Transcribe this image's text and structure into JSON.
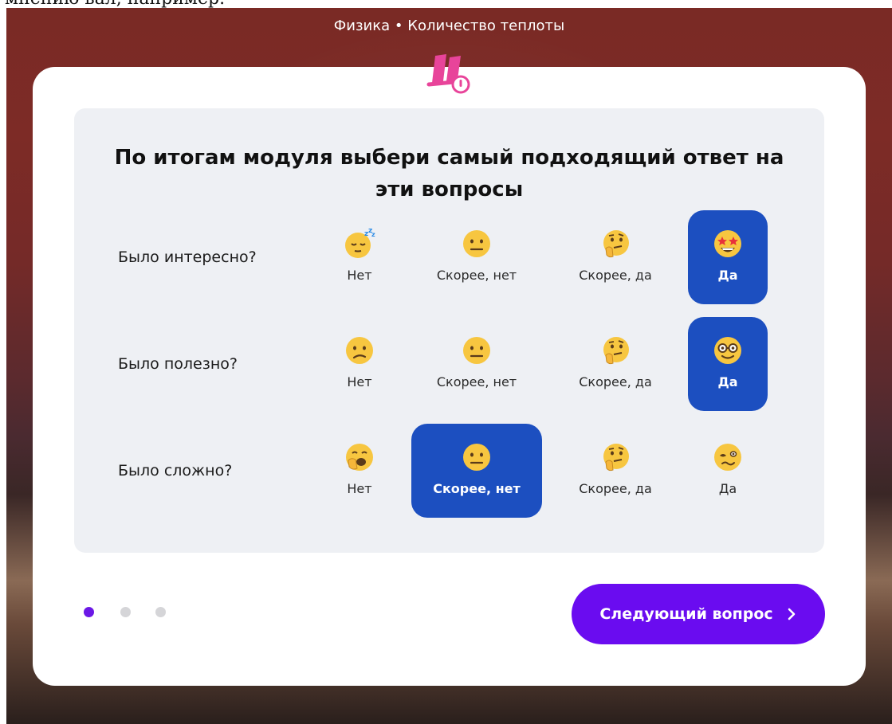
{
  "overlay": {
    "cut_text": "мнению вал, например."
  },
  "header": {
    "breadcrumb": "Физика • Количество теплоты"
  },
  "survey": {
    "title": "По итогам модуля выбери самый подходящий ответ на эти вопросы",
    "options": [
      "Нет",
      "Скорее, нет",
      "Скорее, да",
      "Да"
    ],
    "rows": [
      {
        "question": "Было интересно?",
        "selected": "Да",
        "icons": [
          "sleepy-face-icon",
          "neutral-face-icon",
          "thinking-face-icon",
          "star-struck-face-icon"
        ]
      },
      {
        "question": "Было полезно?",
        "selected": "Да",
        "icons": [
          "confused-face-icon",
          "neutral-face-icon",
          "thinking-face-icon",
          "nerd-face-icon"
        ]
      },
      {
        "question": "Было сложно?",
        "selected": "Скорее, нет",
        "icons": [
          "yawning-face-icon",
          "neutral-face-icon",
          "thinking-face-icon",
          "woozy-face-icon"
        ]
      }
    ]
  },
  "pagination": {
    "total": 3,
    "current": 1
  },
  "footer": {
    "next_label": "Следующий вопрос"
  },
  "colors": {
    "selected": "#1c4fc0",
    "primary_button": "#6a0cf0",
    "active_dot": "#6b18e6",
    "panel_bg": "#eef0f4",
    "logo_pink": "#e8449a"
  }
}
